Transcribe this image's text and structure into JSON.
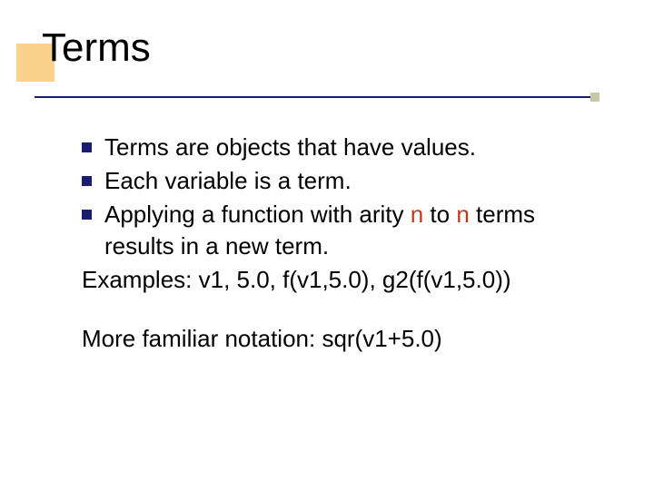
{
  "title": "Terms",
  "bullets": [
    {
      "pre": "Terms are objects that have values.",
      "hl1": "",
      "mid": "",
      "hl2": "",
      "post": ""
    },
    {
      "pre": "Each variable is a term.",
      "hl1": "",
      "mid": "",
      "hl2": "",
      "post": ""
    },
    {
      "pre": "Applying a function with arity ",
      "hl1": "n",
      "mid": " to ",
      "hl2": "n",
      "post": " terms results in a new term."
    }
  ],
  "examples": "Examples: v1,   5.0,  f(v1,5.0), g2(f(v1,5.0))",
  "more": "More familiar notation: sqr(v1+5.0)"
}
